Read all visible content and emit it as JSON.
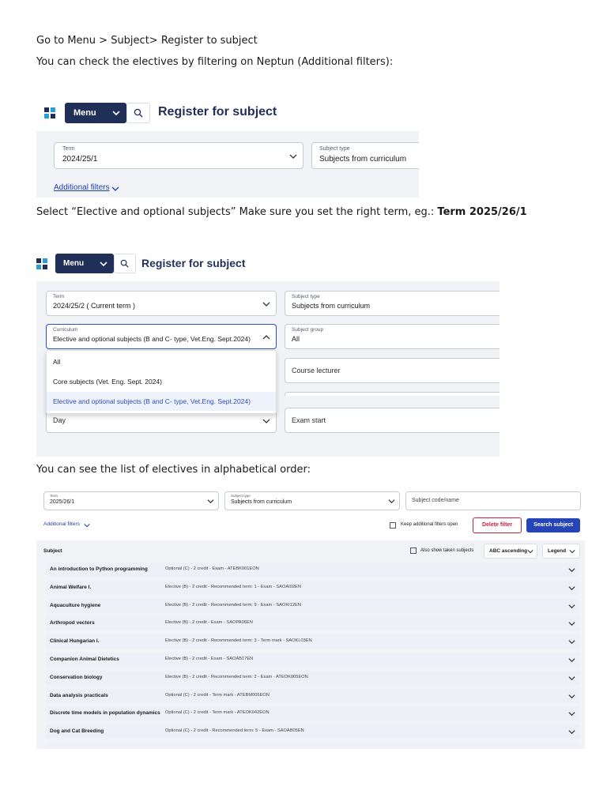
{
  "intro": {
    "line1": "Go to Menu > Subject> Register to subject",
    "line2": "You can check the electives by filtering on Neptun (Additional filters):"
  },
  "shot1": {
    "menu_label": "Menu",
    "title": "Register for subject",
    "term_caption": "Term",
    "term_value": "2024/25/1",
    "subject_type_caption": "Subject type",
    "subject_type_value": "Subjects from curriculum",
    "additional_filters": "Additional filters"
  },
  "instruction": {
    "text": "Select “Elective and optional subjects” Make sure you set the right term, eg.: ",
    "bold": "Term 2025/26/1"
  },
  "shot2": {
    "menu_label": "Menu",
    "title": "Register for subject",
    "term_caption": "Term",
    "term_value": "2024/25/2 ( Current term )",
    "subject_type_caption": "Subject type",
    "subject_type_value": "Subjects from curriculum",
    "curriculum_caption": "Curriculum",
    "curriculum_value": "Elective and optional subjects (B and C- type, Vet.Eng. Sept.2024)",
    "subject_group_caption": "Subject group",
    "subject_group_value": "All",
    "course_lecturer": "Course lecturer",
    "day_value": "Day",
    "exam_start": "Exam start",
    "dropdown_options": [
      "All",
      "Core subjects (Vet. Eng. Sept. 2024)",
      "Elective and optional subjects (B and C- type, Vet.Eng. Sept.2024)"
    ]
  },
  "list_caption": "You can see the list of electives in alphabetical order:",
  "shot3": {
    "term_caption": "Term",
    "term_value": "2025/26/1",
    "subject_type_caption": "Subject type",
    "subject_type_value": "Subjects from curriculum",
    "subject_code_placeholder": "Subject code/name",
    "additional_filters": "Additional filters",
    "keep_open": "Keep additional filters open",
    "delete_filter": "Delete filter",
    "search_subject": "Search subject",
    "subject_header": "Subject",
    "also_show": "Also show taken subjects",
    "sort": "ABC ascending",
    "legend": "Legend",
    "rows": [
      {
        "name": "An introduction to Python programming",
        "desc": "Optional (C) - 2 credit - Exam - ATEBK001EON"
      },
      {
        "name": "Animal Welfare I.",
        "desc": "Elective (B) - 2 credit - Recommended term: 1 - Exam - SAOAI02EN"
      },
      {
        "name": "Aquaculture hygiene",
        "desc": "Elective (B) - 2 credit - Recommended term: 9 - Exam - SAOKI12EN"
      },
      {
        "name": "Arthropod vectors",
        "desc": "Elective (B) - 2 credit - Exam - SAOPA06EN"
      },
      {
        "name": "Clinical Hungarian I.",
        "desc": "Elective (B) - 2 credit - Recommended term: 3 - Term mark - SAOKL03EN"
      },
      {
        "name": "Companion Animal Dietetics",
        "desc": "Elective (B) - 2 credit - Exam - SAOAB17EN"
      },
      {
        "name": "Conservation biology",
        "desc": "Elective (B) - 2 credit - Recommended term: 2 - Exam - ATEOK005EON"
      },
      {
        "name": "Data analysis practicals",
        "desc": "Optional (C) - 2 credit - Term mark - ATEBM005EON"
      },
      {
        "name": "Discrete time models in population dynamics",
        "desc": "Optional (C) - 2 credit - Term mark - ATEOK042EON"
      },
      {
        "name": "Dog and Cat Breeding",
        "desc": "Optional (C) - 2 credit - Recommended term: 5 - Exam - SAOAB05EN"
      }
    ]
  },
  "colors": {
    "navy": "#1f2f57",
    "blue_link": "#1f3fa8",
    "red": "#c2243c",
    "button_blue": "#2444b8",
    "panel_gray": "#f2f3f7"
  }
}
